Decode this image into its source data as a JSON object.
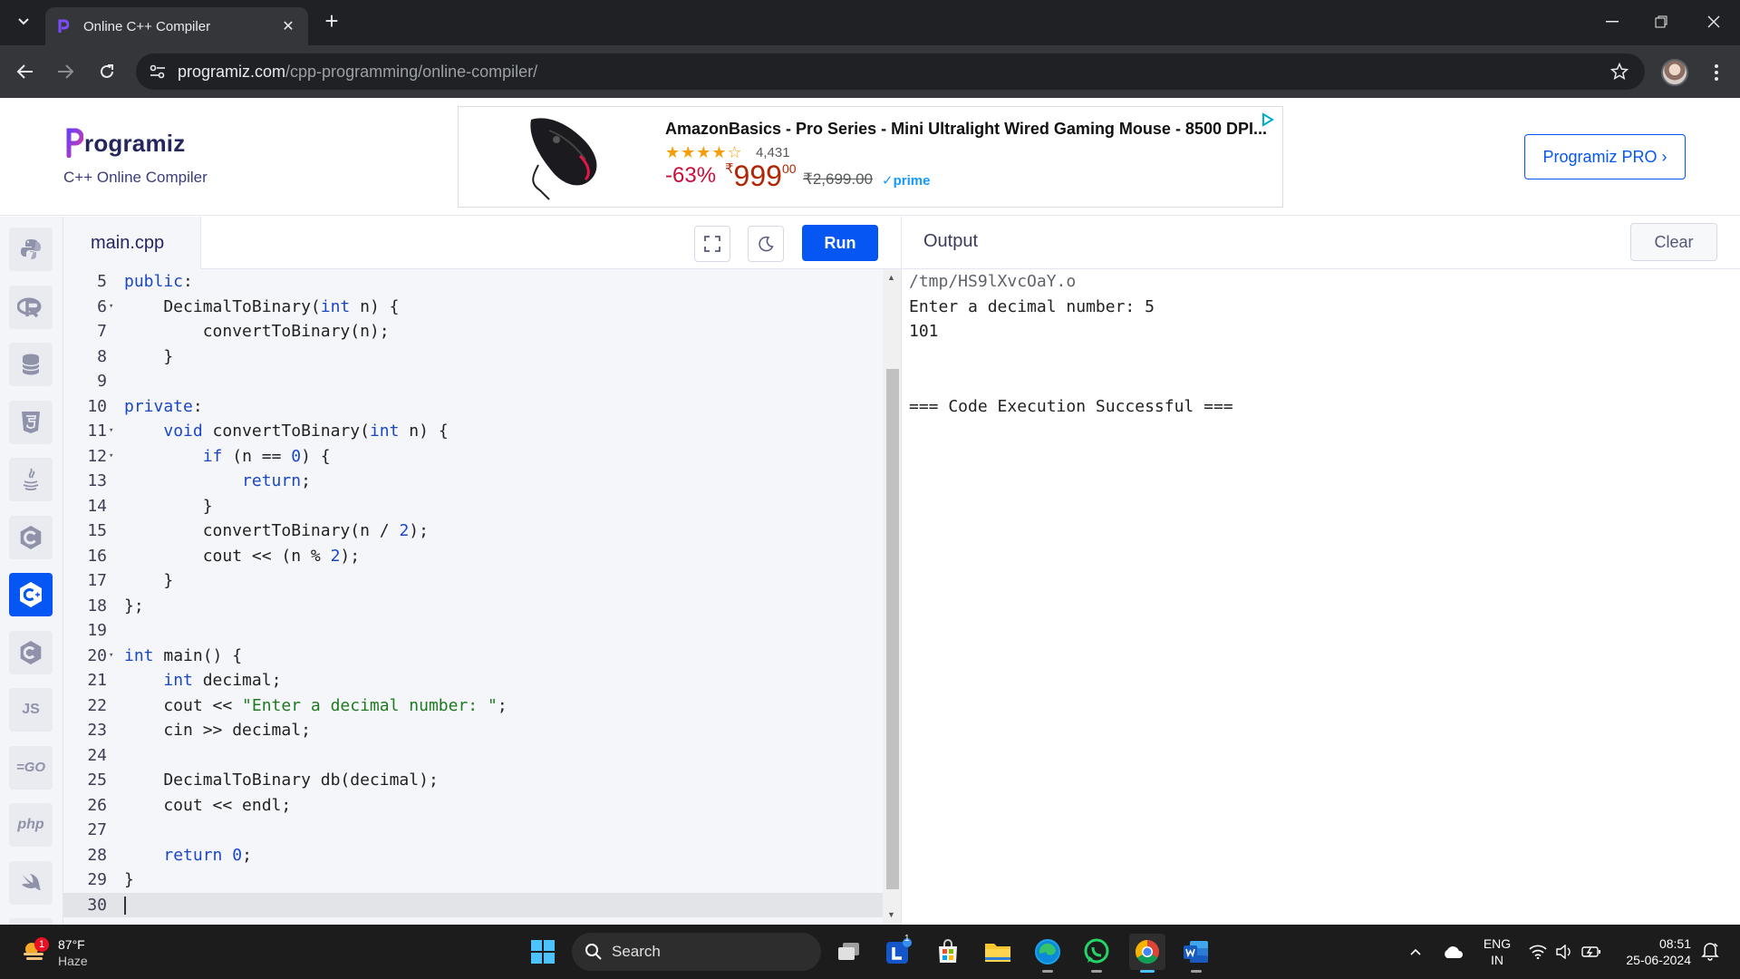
{
  "browser": {
    "tab_title": "Online C++ Compiler",
    "url_host": "programiz.com",
    "url_path": "/cpp-programming/online-compiler/"
  },
  "site": {
    "logo_text": "rogramiz",
    "subtitle": "C++ Online Compiler",
    "pro_button": "Programiz PRO ›",
    "ad": {
      "title": "AmazonBasics - Pro Series - Mini Ultralight Wired Gaming Mouse - 8500 DPI...",
      "stars": "★★★★☆",
      "rating_count": "4,431",
      "discount": "-63%",
      "currency": "₹",
      "price": "999",
      "price_paise": "00",
      "mrp": "₹2,699.00",
      "prime": "✓prime"
    }
  },
  "languages": [
    {
      "name": "python",
      "label": "py",
      "active": false
    },
    {
      "name": "r",
      "label": "R",
      "active": false
    },
    {
      "name": "sql",
      "label": "sql",
      "active": false
    },
    {
      "name": "html",
      "label": "5",
      "active": false
    },
    {
      "name": "java",
      "label": "java",
      "active": false
    },
    {
      "name": "c",
      "label": "C",
      "active": false
    },
    {
      "name": "cpp",
      "label": "C++",
      "active": true
    },
    {
      "name": "csharp",
      "label": "C#",
      "active": false
    },
    {
      "name": "javascript",
      "label": "JS",
      "active": false
    },
    {
      "name": "go",
      "label": "GO",
      "active": false
    },
    {
      "name": "php",
      "label": "php",
      "active": false
    },
    {
      "name": "swift",
      "label": "swift",
      "active": false
    },
    {
      "name": "rust",
      "label": "R",
      "active": false
    }
  ],
  "editor": {
    "filename": "main.cpp",
    "run_label": "Run",
    "lines": [
      {
        "n": "5",
        "fold": false,
        "code": "<span class='kw'>public</span>:"
      },
      {
        "n": "6",
        "fold": true,
        "code": "    DecimalToBinary(<span class='kw'>int</span> n) {"
      },
      {
        "n": "7",
        "fold": false,
        "code": "        convertToBinary(n);"
      },
      {
        "n": "8",
        "fold": false,
        "code": "    }"
      },
      {
        "n": "9",
        "fold": false,
        "code": ""
      },
      {
        "n": "10",
        "fold": false,
        "code": "<span class='kw'>private</span>:"
      },
      {
        "n": "11",
        "fold": true,
        "code": "    <span class='kw'>void</span> convertToBinary(<span class='kw'>int</span> n) {"
      },
      {
        "n": "12",
        "fold": true,
        "code": "        <span class='kw'>if</span> (n == <span class='num'>0</span>) {"
      },
      {
        "n": "13",
        "fold": false,
        "code": "            <span class='kw'>return</span>;"
      },
      {
        "n": "14",
        "fold": false,
        "code": "        }"
      },
      {
        "n": "15",
        "fold": false,
        "code": "        convertToBinary(n / <span class='num'>2</span>);"
      },
      {
        "n": "16",
        "fold": false,
        "code": "        cout << (n % <span class='num'>2</span>);"
      },
      {
        "n": "17",
        "fold": false,
        "code": "    }"
      },
      {
        "n": "18",
        "fold": false,
        "code": "};"
      },
      {
        "n": "19",
        "fold": false,
        "code": ""
      },
      {
        "n": "20",
        "fold": true,
        "code": "<span class='kw'>int</span> main() {"
      },
      {
        "n": "21",
        "fold": false,
        "code": "    <span class='kw'>int</span> decimal;"
      },
      {
        "n": "22",
        "fold": false,
        "code": "    cout << <span class='str'>\"Enter a decimal number: \"</span>;"
      },
      {
        "n": "23",
        "fold": false,
        "code": "    cin >> decimal;"
      },
      {
        "n": "24",
        "fold": false,
        "code": ""
      },
      {
        "n": "25",
        "fold": false,
        "code": "    DecimalToBinary db(decimal);"
      },
      {
        "n": "26",
        "fold": false,
        "code": "    cout << endl;"
      },
      {
        "n": "27",
        "fold": false,
        "code": ""
      },
      {
        "n": "28",
        "fold": false,
        "code": "    <span class='kw'>return</span> <span class='num'>0</span>;"
      },
      {
        "n": "29",
        "fold": false,
        "code": "}"
      },
      {
        "n": "30",
        "fold": false,
        "code": ""
      }
    ],
    "current_line": "30"
  },
  "output": {
    "title": "Output",
    "clear_label": "Clear",
    "lines": [
      "/tmp/HS9lXvcOaY.o",
      "Enter a decimal number: 5",
      "101",
      "",
      "",
      "=== Code Execution Successful ==="
    ]
  },
  "taskbar": {
    "weather_temp": "87°F",
    "weather_cond": "Haze",
    "weather_badge": "1",
    "search_label": "Search",
    "lang_line1": "ENG",
    "lang_line2": "IN",
    "time": "08:51",
    "date": "25-06-2024",
    "loop_badge": "1"
  }
}
